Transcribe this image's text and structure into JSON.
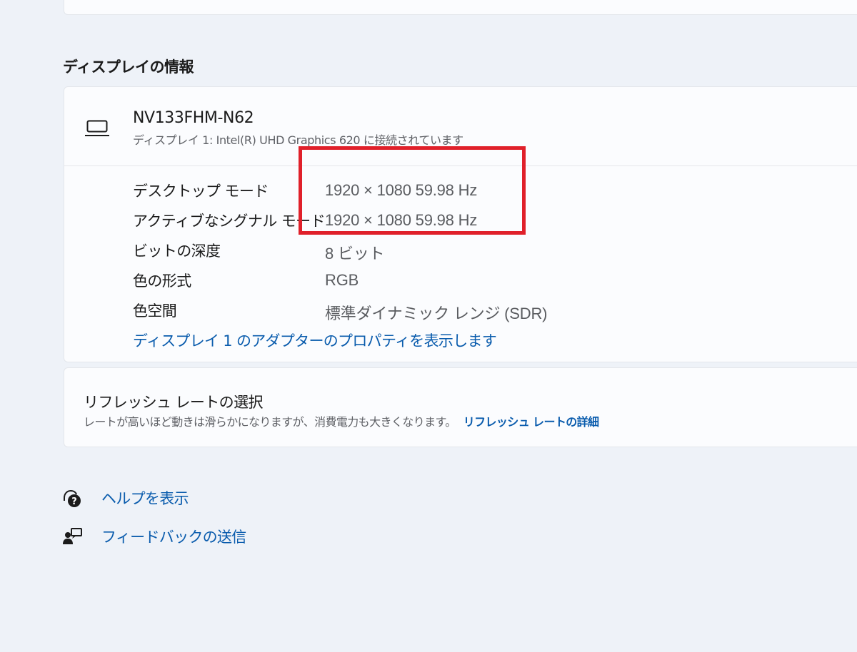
{
  "display_info": {
    "section_title": "ディスプレイの情報",
    "monitor": {
      "icon": "laptop-icon",
      "name": "NV133FHM-N62",
      "subtitle": "ディスプレイ 1: Intel(R) UHD Graphics 620 に接続されています"
    },
    "rows": [
      {
        "label": "デスクトップ モード",
        "value": "1920 × 1080 59.98 Hz"
      },
      {
        "label": "アクティブなシグナル モード",
        "value": "1920 × 1080 59.98 Hz"
      },
      {
        "label": "ビットの深度",
        "value": "8 ビット"
      },
      {
        "label": "色の形式",
        "value": "RGB"
      },
      {
        "label": "色空間",
        "value": "標準ダイナミック レンジ (SDR)"
      }
    ],
    "adapter_link": "ディスプレイ 1 のアダプターのプロパティを表示します"
  },
  "refresh_rate": {
    "title": "リフレッシュ レートの選択",
    "description": "レートが高いほど動きは滑らかになりますが、消費電力も大きくなります。",
    "link": "リフレッシュ レートの詳細"
  },
  "footer_links": [
    {
      "icon": "help-icon",
      "label": "ヘルプを表示"
    },
    {
      "icon": "feedback-icon",
      "label": "フィードバックの送信"
    }
  ],
  "colors": {
    "accent": "#0a5cad",
    "highlight": "#e0202a",
    "background": "#eef2f8",
    "card": "#fbfcfe"
  }
}
